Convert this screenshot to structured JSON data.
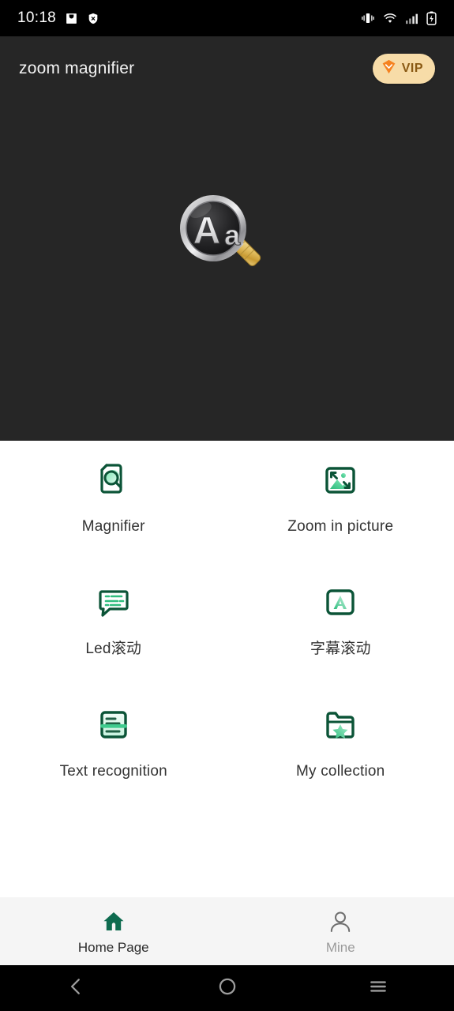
{
  "status_bar": {
    "time": "10:18",
    "left_icons": [
      {
        "name": "inbox-icon"
      },
      {
        "name": "shield-icon"
      }
    ],
    "right_icons": [
      {
        "name": "vibrate-icon"
      },
      {
        "name": "wifi-icon"
      },
      {
        "name": "cellular-signal-icon"
      },
      {
        "name": "battery-charging-icon"
      }
    ]
  },
  "header": {
    "title": "zoom magnifier",
    "vip_label": "VIP",
    "vip_icon": "vip-diamond-icon",
    "vip_bg_color": "#F7DCA8",
    "vip_text_color": "#8A5A14",
    "background_color": "#262626"
  },
  "hero": {
    "art_icon": "magnifier-aa-icon",
    "art_label": "Aa"
  },
  "features": [
    {
      "id": "magnifier",
      "label": "Magnifier",
      "icon": "document-magnifier-icon"
    },
    {
      "id": "zoom-in-picture",
      "label": "Zoom in picture",
      "icon": "picture-zoom-icon"
    },
    {
      "id": "led-scroll",
      "label": "Led滚动",
      "icon": "speech-bubble-text-icon"
    },
    {
      "id": "subtitle-scroll",
      "label": "字幕滚动",
      "icon": "letter-a-box-icon"
    },
    {
      "id": "text-recognition",
      "label": "Text recognition",
      "icon": "text-scan-icon"
    },
    {
      "id": "my-collection",
      "label": "My collection",
      "icon": "folder-star-icon"
    }
  ],
  "bottom_nav": {
    "items": [
      {
        "id": "home",
        "label": "Home Page",
        "icon": "home-icon",
        "active": true
      },
      {
        "id": "mine",
        "label": "Mine",
        "icon": "person-icon",
        "active": false
      }
    ],
    "background_color": "#F5F5F5",
    "active_color": "#0E6B4F",
    "inactive_color": "#9A9A9A"
  },
  "system_nav": {
    "buttons": [
      {
        "id": "back",
        "icon": "chevron-left-icon"
      },
      {
        "id": "home",
        "icon": "circle-icon"
      },
      {
        "id": "recents",
        "icon": "hamburger-icon"
      }
    ]
  },
  "theme": {
    "accent_dark_green": "#0B5437",
    "accent_green": "#3FCB8E",
    "label_color": "#333333"
  }
}
